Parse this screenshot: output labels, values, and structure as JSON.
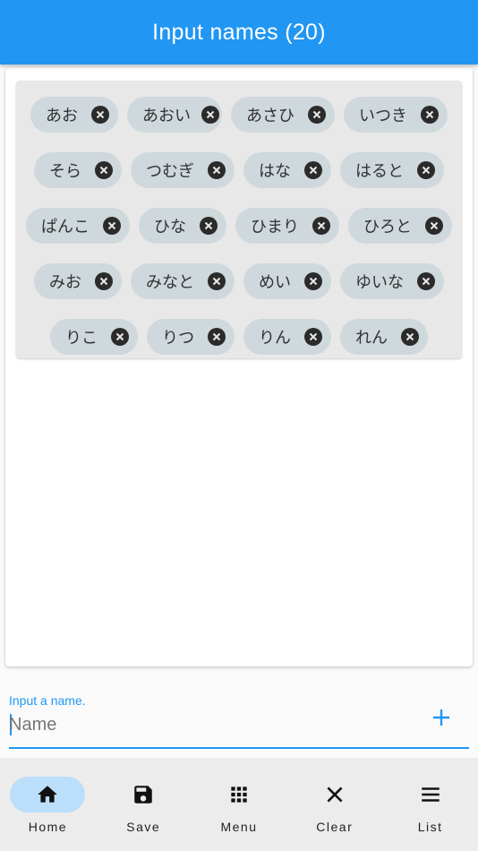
{
  "appbar": {
    "title": "Input names (20)"
  },
  "names": [
    [
      "あお",
      "あおい",
      "あさひ",
      "いつき"
    ],
    [
      "そら",
      "つむぎ",
      "はな",
      "はると"
    ],
    [
      "ぱんこ",
      "ひな",
      "ひまり",
      "ひろと"
    ],
    [
      "みお",
      "みなと",
      "めい",
      "ゆいな"
    ],
    [
      "りこ",
      "りつ",
      "りん",
      "れん"
    ]
  ],
  "input": {
    "label": "Input a name.",
    "placeholder": "Name",
    "value": ""
  },
  "nav": [
    {
      "label": "Home",
      "icon": "home-icon",
      "active": true
    },
    {
      "label": "Save",
      "icon": "save-icon",
      "active": false
    },
    {
      "label": "Menu",
      "icon": "apps-icon",
      "active": false
    },
    {
      "label": "Clear",
      "icon": "close-icon",
      "active": false
    },
    {
      "label": "List",
      "icon": "menu-icon",
      "active": false
    }
  ],
  "colors": {
    "primary": "#2196f3",
    "chip": "#cfd8dc",
    "nav_active": "#bbdefb"
  }
}
